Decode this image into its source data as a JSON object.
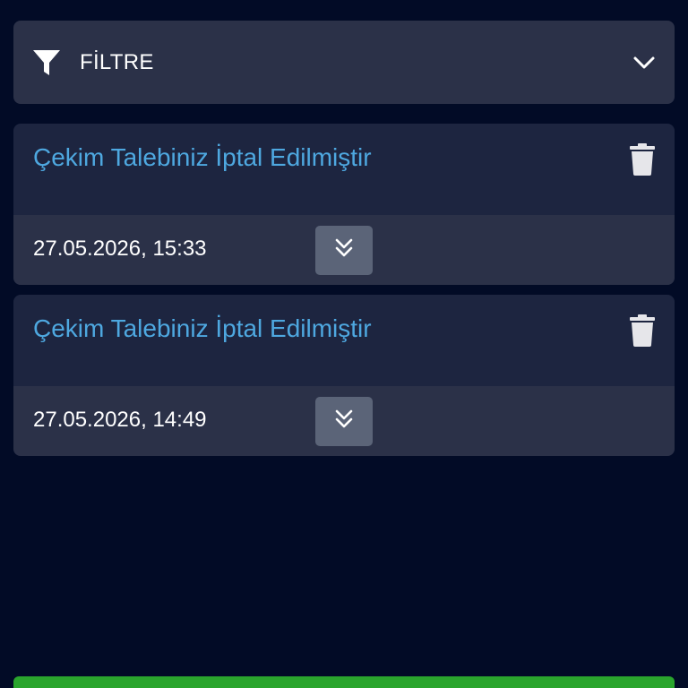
{
  "filter": {
    "label": "FİLTRE",
    "icon": "filter-icon",
    "toggle_icon": "chevron-down-icon"
  },
  "notifications": [
    {
      "title": "Çekim Talebiniz İptal Edilmiştir",
      "date": "27.05.2026, 15:33",
      "delete_icon": "trash-icon",
      "expand_icon": "double-chevron-down-icon"
    },
    {
      "title": "Çekim Talebiniz İptal Edilmiştir",
      "date": "27.05.2026, 14:49",
      "delete_icon": "trash-icon",
      "expand_icon": "double-chevron-down-icon"
    }
  ],
  "colors": {
    "background": "#020b26",
    "panel": "#2b3148",
    "card": "#1d2540",
    "title_accent": "#4ea8e0",
    "action_green": "#2aa52d"
  }
}
